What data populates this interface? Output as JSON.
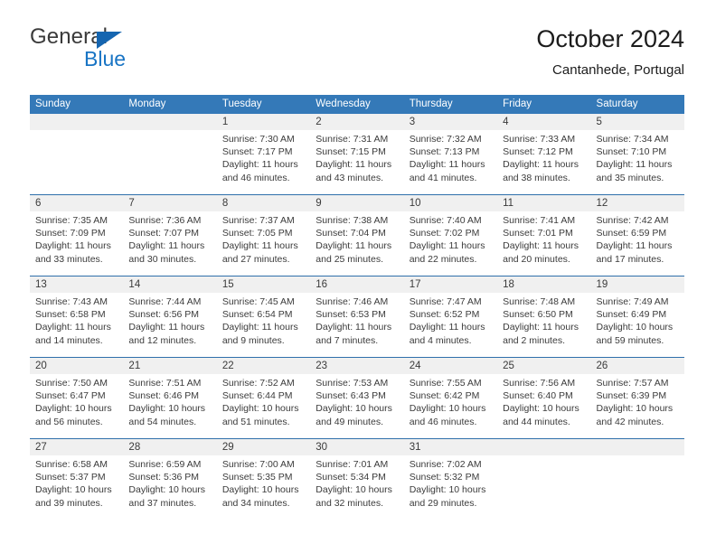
{
  "brand": {
    "name_top": "General",
    "name_bottom": "Blue"
  },
  "header": {
    "title": "October 2024",
    "subtitle": "Cantanhede, Portugal"
  },
  "colors": {
    "header_blue": "#3479b8",
    "separator_blue": "#2f6fab",
    "date_band": "#f0f0f0",
    "brand_blue": "#1874c4",
    "text": "#3b3b3b"
  },
  "weekdays": [
    "Sunday",
    "Monday",
    "Tuesday",
    "Wednesday",
    "Thursday",
    "Friday",
    "Saturday"
  ],
  "weeks": [
    [
      {
        "date": "",
        "lines": []
      },
      {
        "date": "",
        "lines": []
      },
      {
        "date": "1",
        "lines": [
          "Sunrise: 7:30 AM",
          "Sunset: 7:17 PM",
          "Daylight: 11 hours",
          "and 46 minutes."
        ]
      },
      {
        "date": "2",
        "lines": [
          "Sunrise: 7:31 AM",
          "Sunset: 7:15 PM",
          "Daylight: 11 hours",
          "and 43 minutes."
        ]
      },
      {
        "date": "3",
        "lines": [
          "Sunrise: 7:32 AM",
          "Sunset: 7:13 PM",
          "Daylight: 11 hours",
          "and 41 minutes."
        ]
      },
      {
        "date": "4",
        "lines": [
          "Sunrise: 7:33 AM",
          "Sunset: 7:12 PM",
          "Daylight: 11 hours",
          "and 38 minutes."
        ]
      },
      {
        "date": "5",
        "lines": [
          "Sunrise: 7:34 AM",
          "Sunset: 7:10 PM",
          "Daylight: 11 hours",
          "and 35 minutes."
        ]
      }
    ],
    [
      {
        "date": "6",
        "lines": [
          "Sunrise: 7:35 AM",
          "Sunset: 7:09 PM",
          "Daylight: 11 hours",
          "and 33 minutes."
        ]
      },
      {
        "date": "7",
        "lines": [
          "Sunrise: 7:36 AM",
          "Sunset: 7:07 PM",
          "Daylight: 11 hours",
          "and 30 minutes."
        ]
      },
      {
        "date": "8",
        "lines": [
          "Sunrise: 7:37 AM",
          "Sunset: 7:05 PM",
          "Daylight: 11 hours",
          "and 27 minutes."
        ]
      },
      {
        "date": "9",
        "lines": [
          "Sunrise: 7:38 AM",
          "Sunset: 7:04 PM",
          "Daylight: 11 hours",
          "and 25 minutes."
        ]
      },
      {
        "date": "10",
        "lines": [
          "Sunrise: 7:40 AM",
          "Sunset: 7:02 PM",
          "Daylight: 11 hours",
          "and 22 minutes."
        ]
      },
      {
        "date": "11",
        "lines": [
          "Sunrise: 7:41 AM",
          "Sunset: 7:01 PM",
          "Daylight: 11 hours",
          "and 20 minutes."
        ]
      },
      {
        "date": "12",
        "lines": [
          "Sunrise: 7:42 AM",
          "Sunset: 6:59 PM",
          "Daylight: 11 hours",
          "and 17 minutes."
        ]
      }
    ],
    [
      {
        "date": "13",
        "lines": [
          "Sunrise: 7:43 AM",
          "Sunset: 6:58 PM",
          "Daylight: 11 hours",
          "and 14 minutes."
        ]
      },
      {
        "date": "14",
        "lines": [
          "Sunrise: 7:44 AM",
          "Sunset: 6:56 PM",
          "Daylight: 11 hours",
          "and 12 minutes."
        ]
      },
      {
        "date": "15",
        "lines": [
          "Sunrise: 7:45 AM",
          "Sunset: 6:54 PM",
          "Daylight: 11 hours",
          "and 9 minutes."
        ]
      },
      {
        "date": "16",
        "lines": [
          "Sunrise: 7:46 AM",
          "Sunset: 6:53 PM",
          "Daylight: 11 hours",
          "and 7 minutes."
        ]
      },
      {
        "date": "17",
        "lines": [
          "Sunrise: 7:47 AM",
          "Sunset: 6:52 PM",
          "Daylight: 11 hours",
          "and 4 minutes."
        ]
      },
      {
        "date": "18",
        "lines": [
          "Sunrise: 7:48 AM",
          "Sunset: 6:50 PM",
          "Daylight: 11 hours",
          "and 2 minutes."
        ]
      },
      {
        "date": "19",
        "lines": [
          "Sunrise: 7:49 AM",
          "Sunset: 6:49 PM",
          "Daylight: 10 hours",
          "and 59 minutes."
        ]
      }
    ],
    [
      {
        "date": "20",
        "lines": [
          "Sunrise: 7:50 AM",
          "Sunset: 6:47 PM",
          "Daylight: 10 hours",
          "and 56 minutes."
        ]
      },
      {
        "date": "21",
        "lines": [
          "Sunrise: 7:51 AM",
          "Sunset: 6:46 PM",
          "Daylight: 10 hours",
          "and 54 minutes."
        ]
      },
      {
        "date": "22",
        "lines": [
          "Sunrise: 7:52 AM",
          "Sunset: 6:44 PM",
          "Daylight: 10 hours",
          "and 51 minutes."
        ]
      },
      {
        "date": "23",
        "lines": [
          "Sunrise: 7:53 AM",
          "Sunset: 6:43 PM",
          "Daylight: 10 hours",
          "and 49 minutes."
        ]
      },
      {
        "date": "24",
        "lines": [
          "Sunrise: 7:55 AM",
          "Sunset: 6:42 PM",
          "Daylight: 10 hours",
          "and 46 minutes."
        ]
      },
      {
        "date": "25",
        "lines": [
          "Sunrise: 7:56 AM",
          "Sunset: 6:40 PM",
          "Daylight: 10 hours",
          "and 44 minutes."
        ]
      },
      {
        "date": "26",
        "lines": [
          "Sunrise: 7:57 AM",
          "Sunset: 6:39 PM",
          "Daylight: 10 hours",
          "and 42 minutes."
        ]
      }
    ],
    [
      {
        "date": "27",
        "lines": [
          "Sunrise: 6:58 AM",
          "Sunset: 5:37 PM",
          "Daylight: 10 hours",
          "and 39 minutes."
        ]
      },
      {
        "date": "28",
        "lines": [
          "Sunrise: 6:59 AM",
          "Sunset: 5:36 PM",
          "Daylight: 10 hours",
          "and 37 minutes."
        ]
      },
      {
        "date": "29",
        "lines": [
          "Sunrise: 7:00 AM",
          "Sunset: 5:35 PM",
          "Daylight: 10 hours",
          "and 34 minutes."
        ]
      },
      {
        "date": "30",
        "lines": [
          "Sunrise: 7:01 AM",
          "Sunset: 5:34 PM",
          "Daylight: 10 hours",
          "and 32 minutes."
        ]
      },
      {
        "date": "31",
        "lines": [
          "Sunrise: 7:02 AM",
          "Sunset: 5:32 PM",
          "Daylight: 10 hours",
          "and 29 minutes."
        ]
      },
      {
        "date": "",
        "lines": []
      },
      {
        "date": "",
        "lines": []
      }
    ]
  ]
}
